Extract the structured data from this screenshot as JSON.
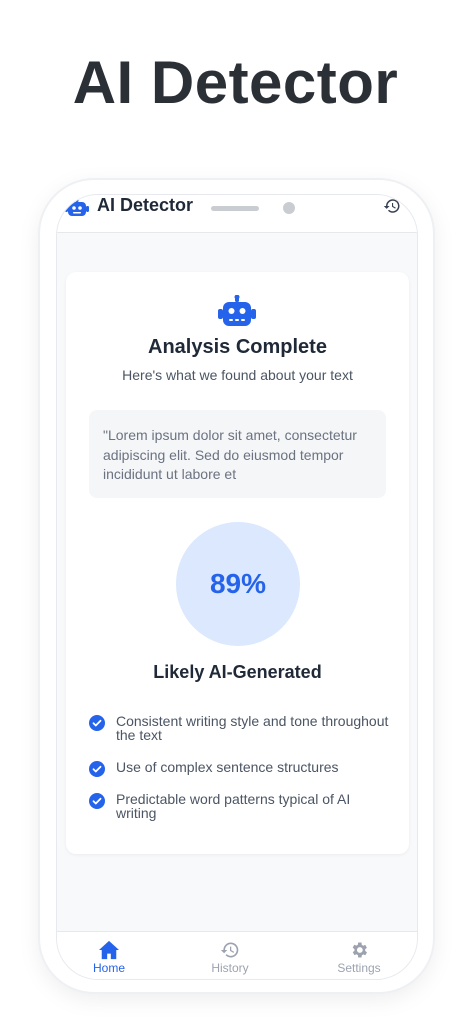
{
  "hero": {
    "title": "AI Detector"
  },
  "header": {
    "title": "AI Detector"
  },
  "card": {
    "title": "Analysis Complete",
    "subtitle": "Here's what we found about your text",
    "text_preview": "\"Lorem ipsum dolor sit amet, consectetur adipiscing elit. Sed do eiusmod tempor incididunt ut labore et",
    "score": "89%",
    "verdict": "Likely AI-Generated",
    "reasons": [
      "Consistent writing style and tone throughout the text",
      "Use of complex sentence structures",
      "Predictable word patterns typical of AI writing"
    ]
  },
  "nav": {
    "items": [
      {
        "label": "Home",
        "icon": "home-icon",
        "active": true
      },
      {
        "label": "History",
        "icon": "history-icon",
        "active": false
      },
      {
        "label": "Settings",
        "icon": "gear-icon",
        "active": false
      }
    ]
  },
  "colors": {
    "accent": "#2563eb",
    "score_bg": "#dbe8fd",
    "inactive": "#9ca3af",
    "text_dark": "#1f2937"
  }
}
